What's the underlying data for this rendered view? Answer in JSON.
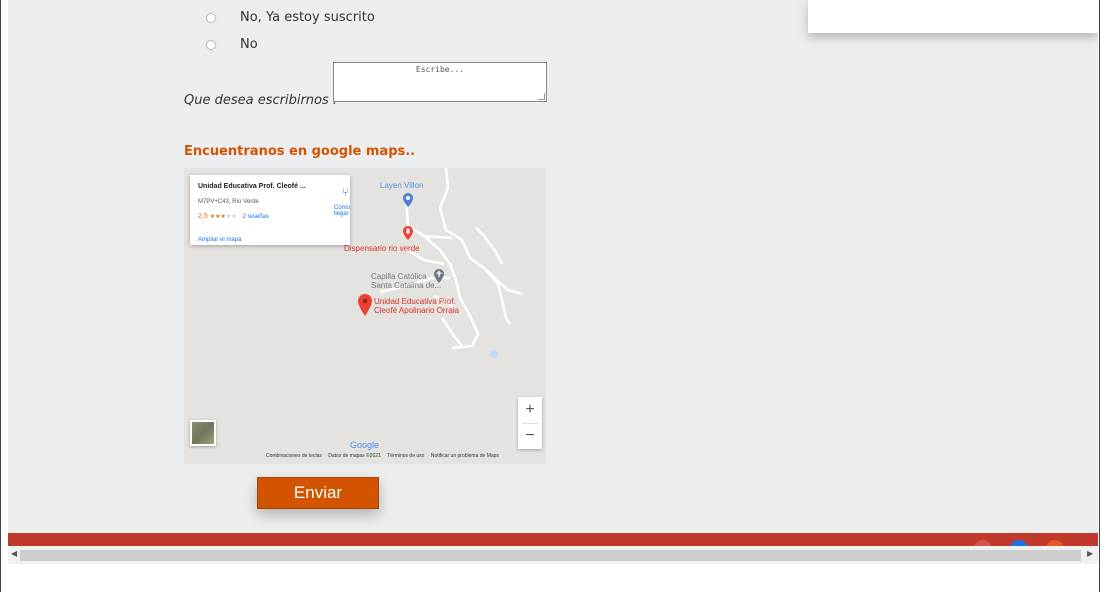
{
  "form": {
    "options": [
      {
        "label": "No, Ya estoy suscrito"
      },
      {
        "label": "No"
      }
    ],
    "message_label": "Que desea escribirnos :",
    "message_placeholder": "Escribe...",
    "maps_heading": "Encuentranos en google maps..",
    "submit_label": "Enviar"
  },
  "map": {
    "card": {
      "title": "Unidad Educativa Prof. Cleofé ...",
      "address": "M7PV+C43, Río Verde",
      "rating": "2,5",
      "stars_on": "★★★",
      "stars_off": "★★",
      "reviews": "2 reseñas",
      "directions": "Cómo llegar",
      "expand": "Ampliar el mapa"
    },
    "places": {
      "top": "Layen Villon",
      "dispensary": "Dispensario rio verde",
      "chapel_1": "Capilla Católica",
      "chapel_2": "Santa Catalina de...",
      "school_1": "Unidad Educativa Prof.",
      "school_2": "Cleofé Apolinario Orrala"
    },
    "zoom_in": "+",
    "zoom_out": "−",
    "logo": "Google",
    "footer": {
      "shortcuts": "Combinaciones de teclas",
      "data": "Datos de mapas ©2021",
      "terms": "Términos de uso",
      "report": "Notificar un problema de Maps"
    },
    "colors": {
      "water_pin": "#4a7fd6",
      "red_pin": "#ea4335",
      "poi_red": "#d93025",
      "poi_blue": "#5a8de0",
      "chapel": "#707a86"
    }
  },
  "colors": {
    "accent": "#d35400",
    "footer_bar": "#c0392b",
    "footer_dot_1": "#e06666",
    "footer_dot_2": "#1a73e8",
    "footer_dot_3": "#e8562b"
  },
  "icons": {
    "radio": "radio-icon",
    "directions": "directions-icon",
    "pin": "map-pin-icon",
    "chapel": "chapel-icon",
    "hospital": "hospital-icon"
  }
}
